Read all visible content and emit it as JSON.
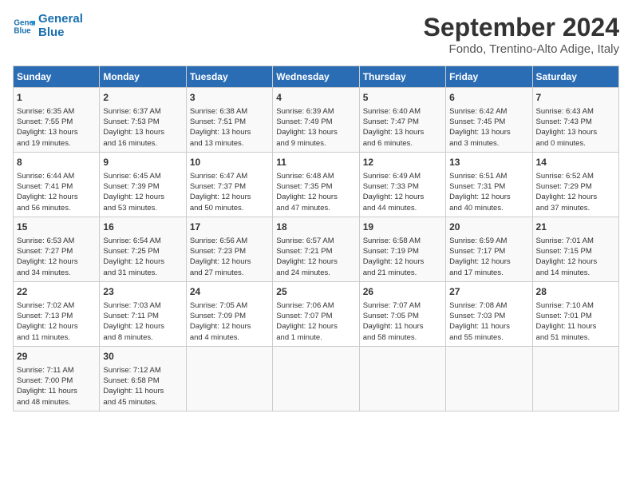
{
  "logo": {
    "line1": "General",
    "line2": "Blue"
  },
  "title": "September 2024",
  "subtitle": "Fondo, Trentino-Alto Adige, Italy",
  "days_of_week": [
    "Sunday",
    "Monday",
    "Tuesday",
    "Wednesday",
    "Thursday",
    "Friday",
    "Saturday"
  ],
  "weeks": [
    [
      {
        "day": "1",
        "info": "Sunrise: 6:35 AM\nSunset: 7:55 PM\nDaylight: 13 hours\nand 19 minutes."
      },
      {
        "day": "2",
        "info": "Sunrise: 6:37 AM\nSunset: 7:53 PM\nDaylight: 13 hours\nand 16 minutes."
      },
      {
        "day": "3",
        "info": "Sunrise: 6:38 AM\nSunset: 7:51 PM\nDaylight: 13 hours\nand 13 minutes."
      },
      {
        "day": "4",
        "info": "Sunrise: 6:39 AM\nSunset: 7:49 PM\nDaylight: 13 hours\nand 9 minutes."
      },
      {
        "day": "5",
        "info": "Sunrise: 6:40 AM\nSunset: 7:47 PM\nDaylight: 13 hours\nand 6 minutes."
      },
      {
        "day": "6",
        "info": "Sunrise: 6:42 AM\nSunset: 7:45 PM\nDaylight: 13 hours\nand 3 minutes."
      },
      {
        "day": "7",
        "info": "Sunrise: 6:43 AM\nSunset: 7:43 PM\nDaylight: 13 hours\nand 0 minutes."
      }
    ],
    [
      {
        "day": "8",
        "info": "Sunrise: 6:44 AM\nSunset: 7:41 PM\nDaylight: 12 hours\nand 56 minutes."
      },
      {
        "day": "9",
        "info": "Sunrise: 6:45 AM\nSunset: 7:39 PM\nDaylight: 12 hours\nand 53 minutes."
      },
      {
        "day": "10",
        "info": "Sunrise: 6:47 AM\nSunset: 7:37 PM\nDaylight: 12 hours\nand 50 minutes."
      },
      {
        "day": "11",
        "info": "Sunrise: 6:48 AM\nSunset: 7:35 PM\nDaylight: 12 hours\nand 47 minutes."
      },
      {
        "day": "12",
        "info": "Sunrise: 6:49 AM\nSunset: 7:33 PM\nDaylight: 12 hours\nand 44 minutes."
      },
      {
        "day": "13",
        "info": "Sunrise: 6:51 AM\nSunset: 7:31 PM\nDaylight: 12 hours\nand 40 minutes."
      },
      {
        "day": "14",
        "info": "Sunrise: 6:52 AM\nSunset: 7:29 PM\nDaylight: 12 hours\nand 37 minutes."
      }
    ],
    [
      {
        "day": "15",
        "info": "Sunrise: 6:53 AM\nSunset: 7:27 PM\nDaylight: 12 hours\nand 34 minutes."
      },
      {
        "day": "16",
        "info": "Sunrise: 6:54 AM\nSunset: 7:25 PM\nDaylight: 12 hours\nand 31 minutes."
      },
      {
        "day": "17",
        "info": "Sunrise: 6:56 AM\nSunset: 7:23 PM\nDaylight: 12 hours\nand 27 minutes."
      },
      {
        "day": "18",
        "info": "Sunrise: 6:57 AM\nSunset: 7:21 PM\nDaylight: 12 hours\nand 24 minutes."
      },
      {
        "day": "19",
        "info": "Sunrise: 6:58 AM\nSunset: 7:19 PM\nDaylight: 12 hours\nand 21 minutes."
      },
      {
        "day": "20",
        "info": "Sunrise: 6:59 AM\nSunset: 7:17 PM\nDaylight: 12 hours\nand 17 minutes."
      },
      {
        "day": "21",
        "info": "Sunrise: 7:01 AM\nSunset: 7:15 PM\nDaylight: 12 hours\nand 14 minutes."
      }
    ],
    [
      {
        "day": "22",
        "info": "Sunrise: 7:02 AM\nSunset: 7:13 PM\nDaylight: 12 hours\nand 11 minutes."
      },
      {
        "day": "23",
        "info": "Sunrise: 7:03 AM\nSunset: 7:11 PM\nDaylight: 12 hours\nand 8 minutes."
      },
      {
        "day": "24",
        "info": "Sunrise: 7:05 AM\nSunset: 7:09 PM\nDaylight: 12 hours\nand 4 minutes."
      },
      {
        "day": "25",
        "info": "Sunrise: 7:06 AM\nSunset: 7:07 PM\nDaylight: 12 hours\nand 1 minute."
      },
      {
        "day": "26",
        "info": "Sunrise: 7:07 AM\nSunset: 7:05 PM\nDaylight: 11 hours\nand 58 minutes."
      },
      {
        "day": "27",
        "info": "Sunrise: 7:08 AM\nSunset: 7:03 PM\nDaylight: 11 hours\nand 55 minutes."
      },
      {
        "day": "28",
        "info": "Sunrise: 7:10 AM\nSunset: 7:01 PM\nDaylight: 11 hours\nand 51 minutes."
      }
    ],
    [
      {
        "day": "29",
        "info": "Sunrise: 7:11 AM\nSunset: 7:00 PM\nDaylight: 11 hours\nand 48 minutes."
      },
      {
        "day": "30",
        "info": "Sunrise: 7:12 AM\nSunset: 6:58 PM\nDaylight: 11 hours\nand 45 minutes."
      },
      {
        "day": "",
        "info": ""
      },
      {
        "day": "",
        "info": ""
      },
      {
        "day": "",
        "info": ""
      },
      {
        "day": "",
        "info": ""
      },
      {
        "day": "",
        "info": ""
      }
    ]
  ]
}
